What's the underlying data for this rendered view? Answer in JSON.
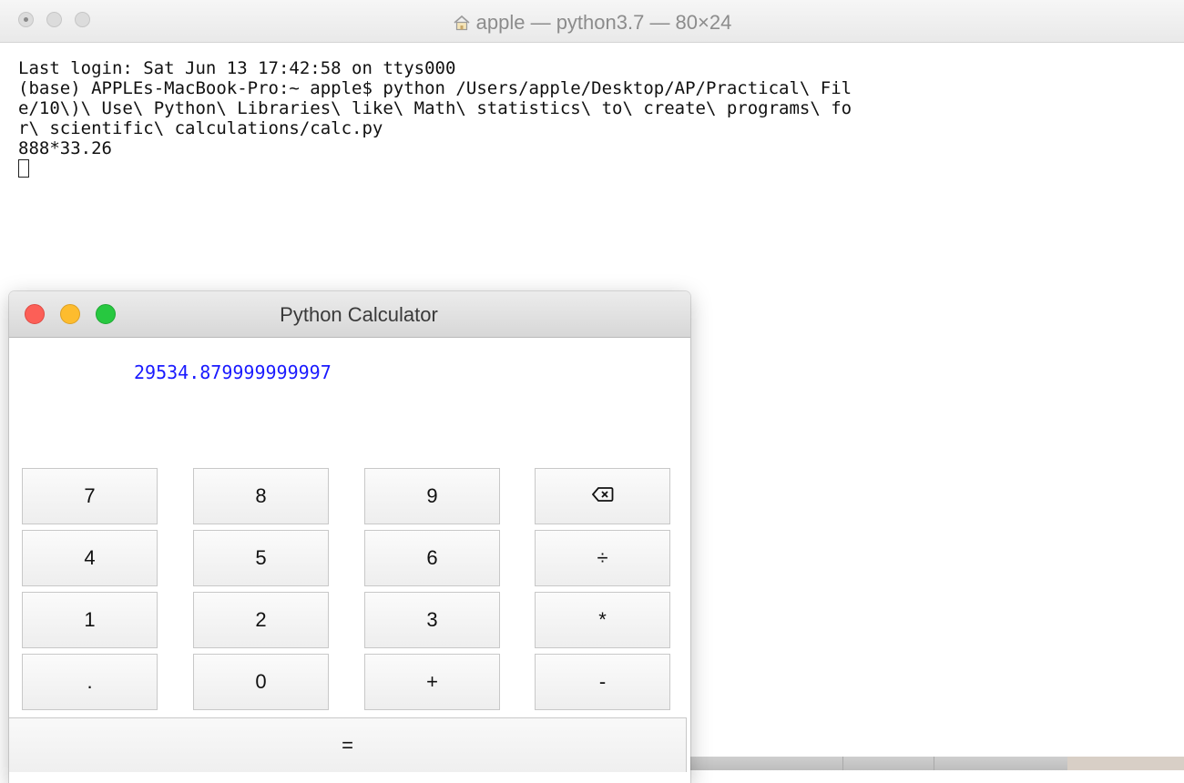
{
  "terminal": {
    "title": "apple — python3.7 — 80×24",
    "lines": [
      "Last login: Sat Jun 13 17:42:58 on ttys000",
      "(base) APPLEs-MacBook-Pro:~ apple$ python /Users/apple/Desktop/AP/Practical\\ Fil",
      "e/10\\)\\ Use\\ Python\\ Libraries\\ like\\ Math\\ statistics\\ to\\ create\\ programs\\ fo",
      "r\\ scientific\\ calculations/calc.py",
      "888*33.26"
    ],
    "icon": "home-icon"
  },
  "calculator": {
    "title": "Python Calculator",
    "display": "29534.879999999997",
    "display_color": "#1a1aff",
    "buttons": [
      [
        "7",
        "8",
        "9",
        "⌫"
      ],
      [
        "4",
        "5",
        "6",
        "÷"
      ],
      [
        "1",
        "2",
        "3",
        "*"
      ],
      [
        ".",
        "0",
        "+",
        "-"
      ]
    ],
    "equals": "="
  }
}
